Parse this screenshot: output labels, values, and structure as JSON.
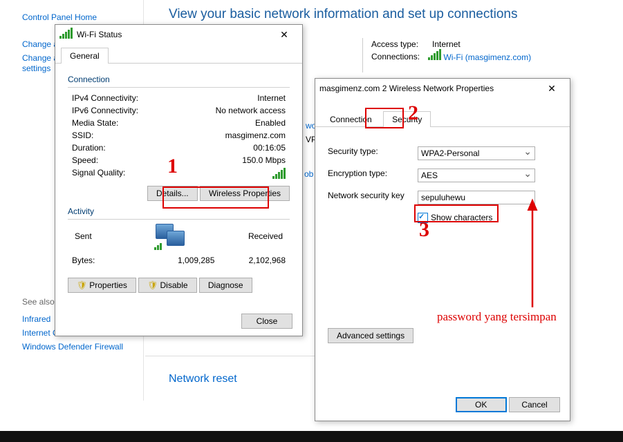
{
  "page": {
    "heading": "View your basic network information and set up connections",
    "cp_home": "Control Panel Home",
    "change_a": "Change a",
    "change_a2": "Change a",
    "settings": "settings",
    "see_also": "See also",
    "links": {
      "infrared": "Infrared",
      "internet_o": "Internet O",
      "wdf": "Windows Defender Firewall"
    },
    "access_type_label": "Access type:",
    "access_type_value": "Internet",
    "connections_label": "Connections:",
    "wifi_link": "Wi-Fi (masgimenz.com)",
    "frag_wo": "wo",
    "frag_vp": "VP",
    "frag_ob": "ob",
    "network_reset": "Network reset"
  },
  "status": {
    "title": "Wi-Fi Status",
    "tab": "General",
    "grp_conn": "Connection",
    "ipv4_l": "IPv4 Connectivity:",
    "ipv4_v": "Internet",
    "ipv6_l": "IPv6 Connectivity:",
    "ipv6_v": "No network access",
    "media_l": "Media State:",
    "media_v": "Enabled",
    "ssid_l": "SSID:",
    "ssid_v": "masgimenz.com",
    "dur_l": "Duration:",
    "dur_v": "00:16:05",
    "speed_l": "Speed:",
    "speed_v": "150.0 Mbps",
    "sigq": "Signal Quality:",
    "details": "Details...",
    "wprops": "Wireless Properties",
    "grp_act": "Activity",
    "sent": "Sent",
    "recv": "Received",
    "bytes_l": "Bytes:",
    "bytes_sent": "1,009,285",
    "bytes_recv": "2,102,968",
    "props": "Properties",
    "disable": "Disable",
    "diag": "Diagnose",
    "close": "Close"
  },
  "props": {
    "title": "masgimenz.com 2 Wireless Network Properties",
    "tab_conn": "Connection",
    "tab_sec": "Security",
    "sec_type_l": "Security type:",
    "sec_type_v": "WPA2-Personal",
    "enc_type_l": "Encryption type:",
    "enc_type_v": "AES",
    "key_l": "Network security key",
    "key_v": "sepuluhewu",
    "show": "Show characters",
    "adv": "Advanced settings",
    "ok": "OK",
    "cancel": "Cancel"
  },
  "anno": {
    "one": "1",
    "two": "2",
    "three": "3",
    "note": "password yang tersimpan"
  }
}
